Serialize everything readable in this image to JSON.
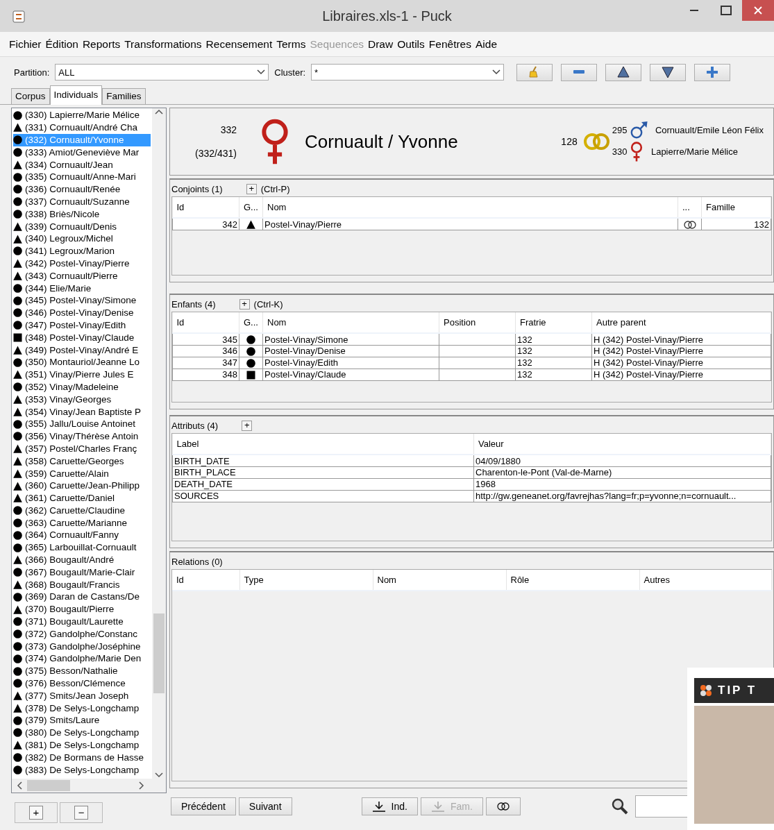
{
  "window": {
    "title": "Libraires.xls-1 - Puck"
  },
  "menu": [
    {
      "label": "Fichier",
      "disabled": false
    },
    {
      "label": "Édition",
      "disabled": false
    },
    {
      "label": "Reports",
      "disabled": false
    },
    {
      "label": "Transformations",
      "disabled": false
    },
    {
      "label": "Recensement",
      "disabled": false
    },
    {
      "label": "Terms",
      "disabled": false
    },
    {
      "label": "Sequences",
      "disabled": true
    },
    {
      "label": "Draw",
      "disabled": false
    },
    {
      "label": "Outils",
      "disabled": false
    },
    {
      "label": "Fenêtres",
      "disabled": false
    },
    {
      "label": "Aide",
      "disabled": false
    }
  ],
  "toolbar": {
    "partition": {
      "label": "Partition:",
      "value": "ALL"
    },
    "cluster": {
      "label": "Cluster:",
      "value": "*"
    }
  },
  "tabs": [
    {
      "label": "Corpus",
      "selected": false
    },
    {
      "label": "Individuals",
      "selected": true
    },
    {
      "label": "Families",
      "selected": false
    }
  ],
  "individuals": [
    {
      "label": "(330) Lapierre/Marie Mélice",
      "kind": "female",
      "selected": false
    },
    {
      "label": "(331) Cornuault/André Cha",
      "kind": "male",
      "selected": false
    },
    {
      "label": "(332) Cornuault/Yvonne",
      "kind": "female",
      "selected": true
    },
    {
      "label": "(333) Amiot/Geneviève Mar",
      "kind": "female",
      "selected": false
    },
    {
      "label": "(334) Cornuault/Jean",
      "kind": "male",
      "selected": false
    },
    {
      "label": "(335) Cornuault/Anne-Mari",
      "kind": "female",
      "selected": false
    },
    {
      "label": "(336) Cornuault/Renée",
      "kind": "female",
      "selected": false
    },
    {
      "label": "(337) Cornuault/Suzanne",
      "kind": "female",
      "selected": false
    },
    {
      "label": "(338) Briès/Nicole",
      "kind": "female",
      "selected": false
    },
    {
      "label": "(339) Cornuault/Denis",
      "kind": "male",
      "selected": false
    },
    {
      "label": "(340) Legroux/Michel",
      "kind": "male",
      "selected": false
    },
    {
      "label": "(341) Legroux/Marion",
      "kind": "female",
      "selected": false
    },
    {
      "label": "(342) Postel-Vinay/Pierre",
      "kind": "male",
      "selected": false
    },
    {
      "label": "(343) Cornuault/Pierre",
      "kind": "male",
      "selected": false
    },
    {
      "label": "(344) Elie/Marie",
      "kind": "female",
      "selected": false
    },
    {
      "label": "(345) Postel-Vinay/Simone",
      "kind": "female",
      "selected": false
    },
    {
      "label": "(346) Postel-Vinay/Denise",
      "kind": "female",
      "selected": false
    },
    {
      "label": "(347) Postel-Vinay/Edith",
      "kind": "female",
      "selected": false
    },
    {
      "label": "(348) Postel-Vinay/Claude",
      "kind": "unknown",
      "selected": false
    },
    {
      "label": "(349) Postel-Vinay/André E",
      "kind": "male",
      "selected": false
    },
    {
      "label": "(350) Montauriol/Jeanne Lo",
      "kind": "female",
      "selected": false
    },
    {
      "label": "(351) Vinay/Pierre Jules E",
      "kind": "male",
      "selected": false
    },
    {
      "label": "(352) Vinay/Madeleine",
      "kind": "female",
      "selected": false
    },
    {
      "label": "(353) Vinay/Georges",
      "kind": "male",
      "selected": false
    },
    {
      "label": "(354) Vinay/Jean Baptiste P",
      "kind": "male",
      "selected": false
    },
    {
      "label": "(355) Jallu/Louise Antoinet",
      "kind": "female",
      "selected": false
    },
    {
      "label": "(356) Vinay/Thérèse Antoin",
      "kind": "female",
      "selected": false
    },
    {
      "label": "(357) Postel/Charles Franç",
      "kind": "male",
      "selected": false
    },
    {
      "label": "(358) Caruette/Georges",
      "kind": "male",
      "selected": false
    },
    {
      "label": "(359) Caruette/Alain",
      "kind": "male",
      "selected": false
    },
    {
      "label": "(360) Caruette/Jean-Philipp",
      "kind": "male",
      "selected": false
    },
    {
      "label": "(361) Caruette/Daniel",
      "kind": "male",
      "selected": false
    },
    {
      "label": "(362) Caruette/Claudine",
      "kind": "female",
      "selected": false
    },
    {
      "label": "(363) Caruette/Marianne",
      "kind": "female",
      "selected": false
    },
    {
      "label": "(364) Cornuault/Fanny",
      "kind": "female",
      "selected": false
    },
    {
      "label": "(365) Larbouillat-Cornuault",
      "kind": "female",
      "selected": false
    },
    {
      "label": "(366) Bougault/André",
      "kind": "male",
      "selected": false
    },
    {
      "label": "(367) Bougault/Marie-Clair",
      "kind": "female",
      "selected": false
    },
    {
      "label": "(368) Bougault/Francis",
      "kind": "male",
      "selected": false
    },
    {
      "label": "(369) Daran de Castans/De",
      "kind": "female",
      "selected": false
    },
    {
      "label": "(370) Bougault/Pierre",
      "kind": "male",
      "selected": false
    },
    {
      "label": "(371) Bougault/Laurette",
      "kind": "female",
      "selected": false
    },
    {
      "label": "(372) Gandolphe/Constanc",
      "kind": "female",
      "selected": false
    },
    {
      "label": "(373) Gandolphe/Joséphine",
      "kind": "female",
      "selected": false
    },
    {
      "label": "(374) Gandolphe/Marie Den",
      "kind": "female",
      "selected": false
    },
    {
      "label": "(375) Besson/Nathalie",
      "kind": "female",
      "selected": false
    },
    {
      "label": "(376) Besson/Clémence",
      "kind": "female",
      "selected": false
    },
    {
      "label": "(377) Smits/Jean Joseph",
      "kind": "male",
      "selected": false
    },
    {
      "label": "(378) De Selys-Longchamp",
      "kind": "male",
      "selected": false
    },
    {
      "label": "(379) Smits/Laure",
      "kind": "female",
      "selected": false
    },
    {
      "label": "(380) De Selys-Longchamp",
      "kind": "female",
      "selected": false
    },
    {
      "label": "(381) De Selys-Longchamp",
      "kind": "male",
      "selected": false
    },
    {
      "label": "(382) De Bormans de Hasse",
      "kind": "female",
      "selected": false
    },
    {
      "label": "(383) De Selys-Longchamp",
      "kind": "female",
      "selected": false
    }
  ],
  "list_buttons": [
    "+",
    "−"
  ],
  "header": {
    "id": "332",
    "index": "(332/431)",
    "kind": "female",
    "name": "Cornuault / Yvonne",
    "family": "128",
    "parents": [
      {
        "id": "295",
        "kind": "male",
        "name": "Cornuault/Emile Léon Félix"
      },
      {
        "id": "330",
        "kind": "female",
        "name": "Lapierre/Marie Mélice"
      }
    ]
  },
  "conjoints": {
    "title": "Conjoints (1)",
    "add": "+",
    "shortcut": "(Ctrl-P)",
    "columns": [
      "Id",
      "G...",
      "Nom",
      "...",
      "Famille"
    ],
    "rows": [
      {
        "id": "342",
        "kind": "male",
        "name": "Postel-Vinay/Pierre",
        "family": "132"
      }
    ]
  },
  "enfants": {
    "title": "Enfants (4)",
    "add": "+",
    "shortcut": "(Ctrl-K)",
    "columns": [
      "Id",
      "G...",
      "Nom",
      "Position",
      "Fratrie",
      "Autre parent"
    ],
    "rows": [
      {
        "id": "345",
        "kind": "female",
        "name": "Postel-Vinay/Simone",
        "fratrie": "132",
        "other_parent": "H (342) Postel-Vinay/Pierre"
      },
      {
        "id": "346",
        "kind": "female",
        "name": "Postel-Vinay/Denise",
        "fratrie": "132",
        "other_parent": "H (342) Postel-Vinay/Pierre"
      },
      {
        "id": "347",
        "kind": "female",
        "name": "Postel-Vinay/Edith",
        "fratrie": "132",
        "other_parent": "H (342) Postel-Vinay/Pierre"
      },
      {
        "id": "348",
        "kind": "unknown",
        "name": "Postel-Vinay/Claude",
        "fratrie": "132",
        "other_parent": "H (342) Postel-Vinay/Pierre"
      }
    ]
  },
  "attributs": {
    "title": "Attributs (4)",
    "add": "+",
    "columns": [
      "Label",
      "Valeur"
    ],
    "rows": [
      {
        "label": "BIRTH_DATE",
        "value": "04/09/1880"
      },
      {
        "label": "BIRTH_PLACE",
        "value": "Charenton-le-Pont (Val-de-Marne)"
      },
      {
        "label": "DEATH_DATE",
        "value": "1968"
      },
      {
        "label": "SOURCES",
        "value": "http://gw.geneanet.org/favrejhas?lang=fr;p=yvonne;n=cornuault..."
      }
    ]
  },
  "relations": {
    "title": "Relations (0)",
    "columns": [
      "Id",
      "Type",
      "Nom",
      "Rôle",
      "Autres"
    ]
  },
  "bottom_buttons": [
    {
      "kind": "text",
      "label": "Précédent",
      "disabled": false
    },
    {
      "kind": "text",
      "label": "Suivant",
      "disabled": false
    },
    {
      "kind": "download",
      "label": "Ind.",
      "disabled": false
    },
    {
      "kind": "download",
      "label": "Fam.",
      "disabled": true
    },
    {
      "kind": "rings",
      "disabled": false
    }
  ],
  "overlay": {
    "title": "TIP T"
  }
}
